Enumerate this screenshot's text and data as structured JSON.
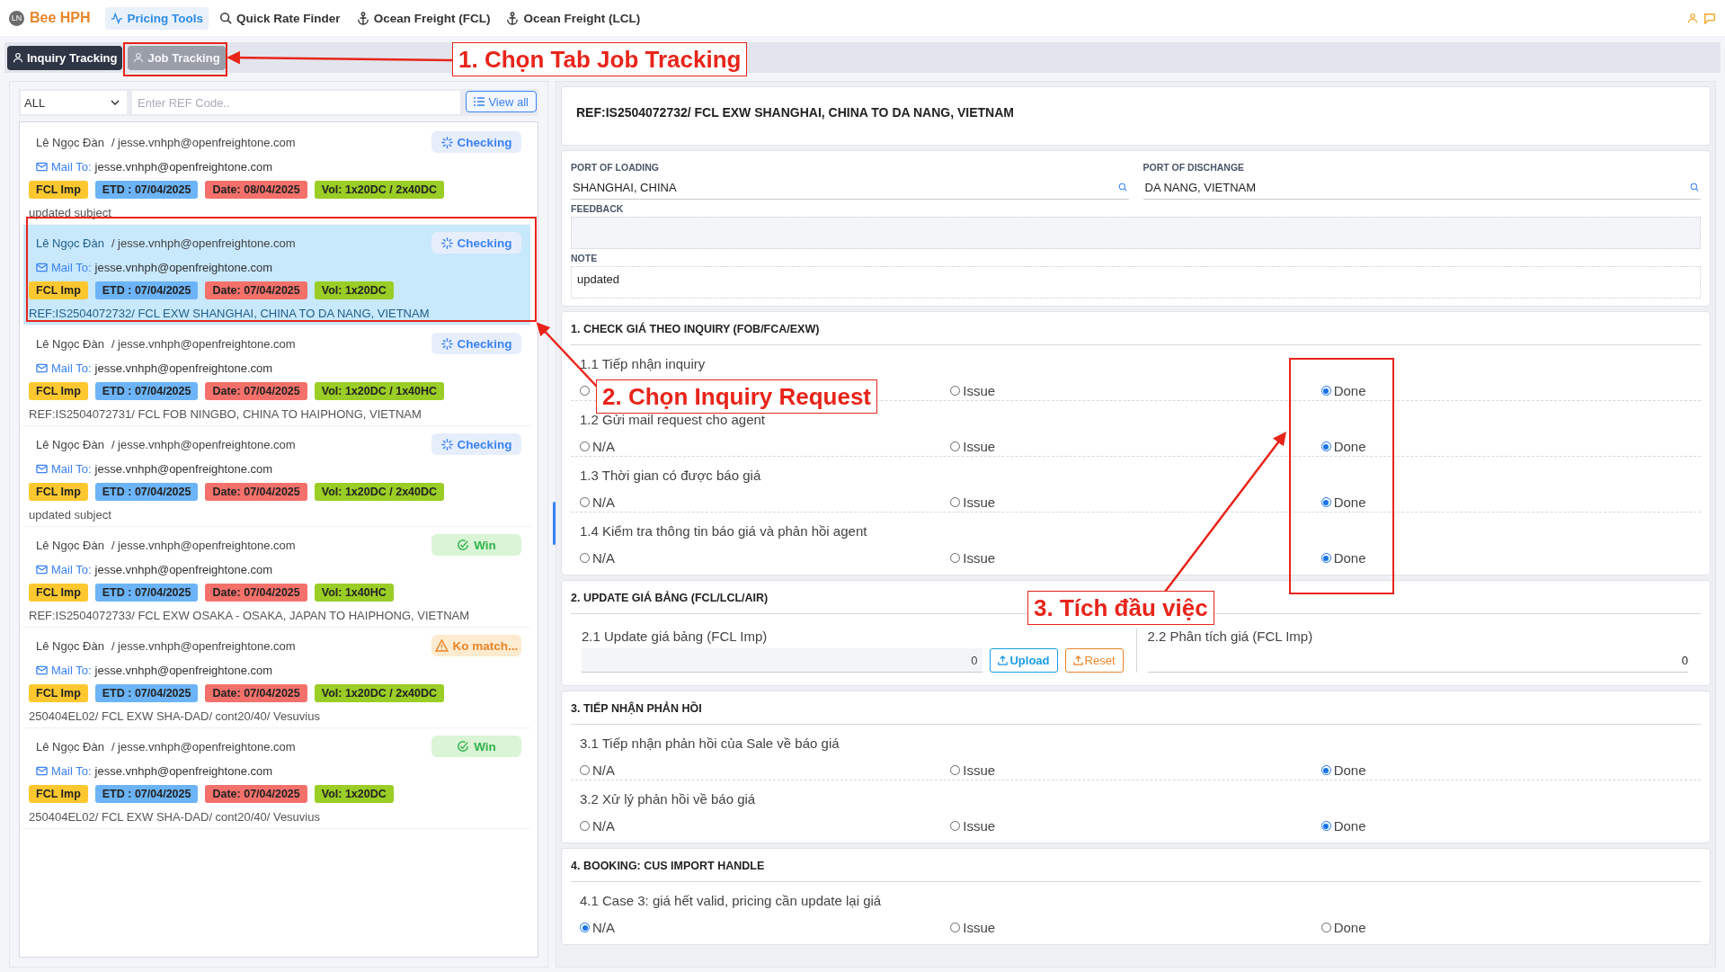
{
  "app": {
    "avatar": "LN",
    "brand": "Bee HPH"
  },
  "nav": [
    {
      "label": "Pricing Tools",
      "selected": true
    },
    {
      "label": "Quick Rate Finder",
      "selected": false
    },
    {
      "label": "Ocean Freight (FCL)",
      "selected": false
    },
    {
      "label": "Ocean Freight (LCL)",
      "selected": false
    }
  ],
  "tabs": [
    {
      "label": "Inquiry Tracking",
      "selected": true
    },
    {
      "label": "Job Tracking",
      "selected": false
    }
  ],
  "filter": {
    "select": "ALL",
    "placeholder": "Enter REF Code..",
    "view_all": "View all"
  },
  "inquiries": [
    {
      "name": "Lê Ngọc Đàn",
      "email": "/ jesse.vnhph@openfreightone.com",
      "status": {
        "kind": "checking",
        "label": "Checking"
      },
      "mail_label": "Mail To:",
      "mail_to": "jesse.vnhph@openfreightone.com",
      "tags": [
        {
          "label": "FCL Imp",
          "color": "#fdc82f"
        },
        {
          "label": "ETD : 07/04/2025",
          "color": "#6cb4f7"
        },
        {
          "label": "Date: 08/04/2025",
          "color": "#f4716b"
        },
        {
          "label": "Vol: 1x20DC / 2x40DC",
          "color": "#9acd25"
        }
      ],
      "subject": "updated subject",
      "selected": false
    },
    {
      "name": "Lê Ngọc Đàn",
      "email": "/ jesse.vnhph@openfreightone.com",
      "status": {
        "kind": "checking",
        "label": "Checking"
      },
      "mail_label": "Mail To:",
      "mail_to": "jesse.vnhph@openfreightone.com",
      "tags": [
        {
          "label": "FCL Imp",
          "color": "#fdc82f"
        },
        {
          "label": "ETD : 07/04/2025",
          "color": "#6cb4f7"
        },
        {
          "label": "Date: 07/04/2025",
          "color": "#f4716b"
        },
        {
          "label": "Vol: 1x20DC",
          "color": "#9acd25"
        }
      ],
      "subject": "REF:IS2504072732/ FCL EXW SHANGHAI, CHINA TO DA NANG, VIETNAM",
      "selected": true
    },
    {
      "name": "Lê Ngọc Đàn",
      "email": "/ jesse.vnhph@openfreightone.com",
      "status": {
        "kind": "checking",
        "label": "Checking"
      },
      "mail_label": "Mail To:",
      "mail_to": "jesse.vnhph@openfreightone.com",
      "tags": [
        {
          "label": "FCL Imp",
          "color": "#fdc82f"
        },
        {
          "label": "ETD : 07/04/2025",
          "color": "#6cb4f7"
        },
        {
          "label": "Date: 07/04/2025",
          "color": "#f4716b"
        },
        {
          "label": "Vol: 1x20DC / 1x40HC",
          "color": "#9acd25"
        }
      ],
      "subject": "REF:IS2504072731/ FCL FOB NINGBO, CHINA TO HAIPHONG, VIETNAM",
      "selected": false
    },
    {
      "name": "Lê Ngọc Đàn",
      "email": "/ jesse.vnhph@openfreightone.com",
      "status": {
        "kind": "checking",
        "label": "Checking"
      },
      "mail_label": "Mail To:",
      "mail_to": "jesse.vnhph@openfreightone.com",
      "tags": [
        {
          "label": "FCL Imp",
          "color": "#fdc82f"
        },
        {
          "label": "ETD : 07/04/2025",
          "color": "#6cb4f7"
        },
        {
          "label": "Date: 07/04/2025",
          "color": "#f4716b"
        },
        {
          "label": "Vol: 1x20DC / 2x40DC",
          "color": "#9acd25"
        }
      ],
      "subject": "updated subject",
      "selected": false
    },
    {
      "name": "Lê Ngọc Đàn",
      "email": "/ jesse.vnhph@openfreightone.com",
      "status": {
        "kind": "win",
        "label": "Win"
      },
      "mail_label": "Mail To:",
      "mail_to": "jesse.vnhph@openfreightone.com",
      "tags": [
        {
          "label": "FCL Imp",
          "color": "#fdc82f"
        },
        {
          "label": "ETD : 07/04/2025",
          "color": "#6cb4f7"
        },
        {
          "label": "Date: 07/04/2025",
          "color": "#f4716b"
        },
        {
          "label": "Vol: 1x40HC",
          "color": "#9acd25"
        }
      ],
      "subject": "REF:IS2504072733/ FCL EXW OSAKA - OSAKA, JAPAN TO HAIPHONG, VIETNAM",
      "selected": false
    },
    {
      "name": "Lê Ngọc Đàn",
      "email": "/ jesse.vnhph@openfreightone.com",
      "status": {
        "kind": "nomatch",
        "label": "Ko match..."
      },
      "mail_label": "Mail To:",
      "mail_to": "jesse.vnhph@openfreightone.com",
      "tags": [
        {
          "label": "FCL Imp",
          "color": "#fdc82f"
        },
        {
          "label": "ETD : 07/04/2025",
          "color": "#6cb4f7"
        },
        {
          "label": "Date: 07/04/2025",
          "color": "#f4716b"
        },
        {
          "label": "Vol: 1x20DC / 2x40DC",
          "color": "#9acd25"
        }
      ],
      "subject": "250404EL02/ FCL EXW SHA-DAD/ cont20/40/ Vesuvius",
      "selected": false
    },
    {
      "name": "Lê Ngọc Đàn",
      "email": "/ jesse.vnhph@openfreightone.com",
      "status": {
        "kind": "win",
        "label": "Win"
      },
      "mail_label": "Mail To:",
      "mail_to": "jesse.vnhph@openfreightone.com",
      "tags": [
        {
          "label": "FCL Imp",
          "color": "#fdc82f"
        },
        {
          "label": "ETD : 07/04/2025",
          "color": "#6cb4f7"
        },
        {
          "label": "Date: 07/04/2025",
          "color": "#f4716b"
        },
        {
          "label": "Vol: 1x20DC",
          "color": "#9acd25"
        }
      ],
      "subject": "250404EL02/ FCL EXW SHA-DAD/ cont20/40/ Vesuvius",
      "selected": false
    }
  ],
  "detail": {
    "title": "REF:IS2504072732/ FCL EXW SHANGHAI, CHINA TO DA NANG, VIETNAM",
    "port_of_loading": {
      "label": "PORT OF LOADING",
      "value": "SHANGHAI, CHINA"
    },
    "port_of_discharge": {
      "label": "PORT OF DISCHANGE",
      "value": "DA NANG, VIETNAM"
    },
    "feedback": {
      "label": "FEEDBACK"
    },
    "note": {
      "label": "NOTE",
      "value": "updated"
    }
  },
  "sections": [
    {
      "title": "1. CHECK GIÁ THEO INQUIRY (FOB/FCA/EXW)",
      "kind": "checklist",
      "items": [
        {
          "label": "1.1 Tiếp nhận inquiry",
          "options": [
            {
              "selected": false
            },
            {
              "label": "Issue",
              "selected": false
            },
            {
              "label": "Done",
              "selected": true
            }
          ]
        },
        {
          "label": "1.2 Gửi mail request cho agent",
          "options": [
            {
              "label": "N/A",
              "selected": false
            },
            {
              "label": "Issue",
              "selected": false
            },
            {
              "label": "Done",
              "selected": true
            }
          ]
        },
        {
          "label": "1.3 Thời gian có được báo giá",
          "options": [
            {
              "label": "N/A",
              "selected": false
            },
            {
              "label": "Issue",
              "selected": false
            },
            {
              "label": "Done",
              "selected": true
            }
          ]
        },
        {
          "label": "1.4 Kiểm tra thông tin báo giá và phản hồi agent",
          "options": [
            {
              "label": "N/A",
              "selected": false
            },
            {
              "label": "Issue",
              "selected": false
            },
            {
              "label": "Done",
              "selected": true
            }
          ]
        }
      ]
    },
    {
      "title": "2. UPDATE GIÁ BẢNG (FCL/LCL/AIR)",
      "kind": "fields",
      "items": [
        {
          "kind": "upload",
          "label": "2.1 Update giá bảng (FCL Imp)",
          "value": "0",
          "buttons": [
            "Upload",
            "Reset"
          ]
        },
        {
          "kind": "number",
          "label": "2.2 Phân tích giá (FCL Imp)",
          "value": "0"
        }
      ]
    },
    {
      "title": "3. TIẾP NHẬN PHẢN HỒI",
      "kind": "checklist",
      "items": [
        {
          "label": "3.1 Tiếp nhận phản hồi của Sale về báo giá",
          "options": [
            {
              "label": "N/A",
              "selected": false
            },
            {
              "label": "Issue",
              "selected": false
            },
            {
              "label": "Done",
              "selected": true
            }
          ]
        },
        {
          "label": "3.2 Xử lý phản hồi về báo giá",
          "options": [
            {
              "label": "N/A",
              "selected": false
            },
            {
              "label": "Issue",
              "selected": false
            },
            {
              "label": "Done",
              "selected": true
            }
          ]
        }
      ]
    },
    {
      "title": "4. BOOKING: CUS IMPORT HANDLE",
      "kind": "checklist",
      "items": [
        {
          "label": "4.1 Case 3: giá hết valid, pricing cần update lại giá",
          "options": [
            {
              "label": "N/A",
              "selected": true
            },
            {
              "label": "Issue",
              "selected": false
            },
            {
              "label": "Done",
              "selected": false
            }
          ]
        }
      ]
    }
  ],
  "annotations": [
    {
      "text": "1. Chọn Tab Job Tracking"
    },
    {
      "text": "2. Chọn Inquiry Request"
    },
    {
      "text": "3. Tích đầu việc"
    }
  ]
}
